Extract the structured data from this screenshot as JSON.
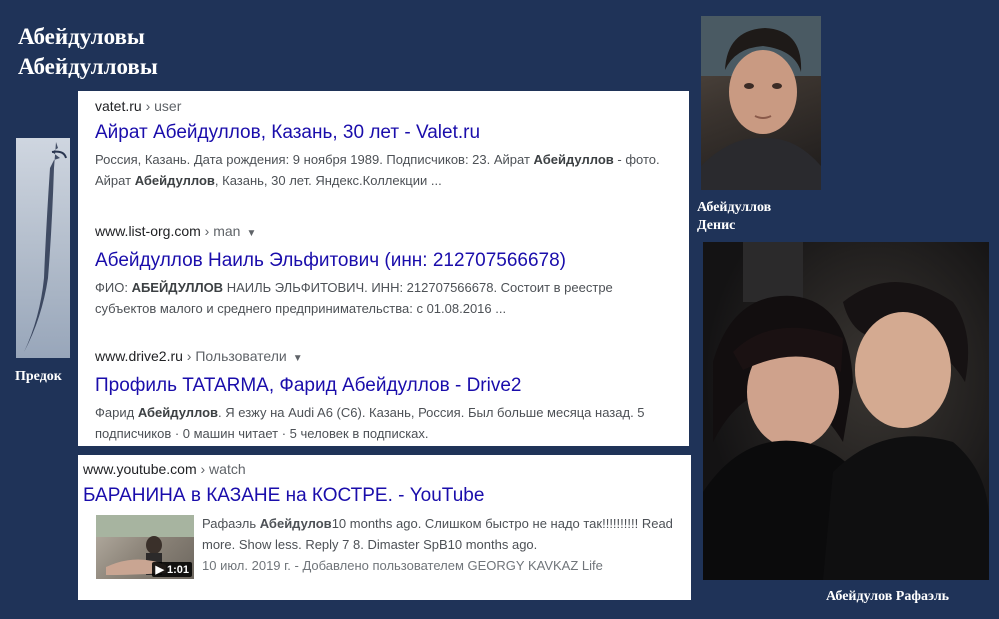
{
  "heading": {
    "line1": "Абейдуловы",
    "line2": "Абейдулловы"
  },
  "captions": {
    "ancestor": "Предок",
    "denis_line1": "Абейдуллов",
    "denis_line2": "Денис",
    "rafael": "Абейдулов Рафаэль"
  },
  "results": [
    {
      "site": "vatet.ru",
      "crumb": " › user",
      "caret": "",
      "title": "Айрат Абейдуллов, Казань, 30 лет - Valet.ru",
      "snippet": [
        {
          "t": "Россия, Казань. Дата рождения: 9 ноября 1989. Подписчиков: 23. Айрат "
        },
        {
          "b": "Абейдуллов"
        },
        {
          "t": " - фото. Айрат "
        },
        {
          "b": "Абейдуллов"
        },
        {
          "t": ", Казань, 30 лет. Яндекс.Коллекции ..."
        }
      ]
    },
    {
      "site": "www.list-org.com",
      "crumb": " › man",
      "caret": "▼",
      "title": "Абейдуллов Наиль Эльфитович (инн: 212707566678)",
      "snippet": [
        {
          "t": "ФИО: "
        },
        {
          "b": "АБЕЙДУЛЛОВ"
        },
        {
          "t": " НАИЛЬ ЭЛЬФИТОВИЧ. ИНН: 212707566678. Состоит в реестре субъектов малого и среднего предпринимательства: с 01.08.2016 ..."
        }
      ]
    },
    {
      "site": "www.drive2.ru",
      "crumb": " › Пользователи",
      "caret": "▼",
      "title": "Профиль TATARMA, Фарид Абейдуллов - Drive2",
      "snippet": [
        {
          "t": "Фарид "
        },
        {
          "b": "Абейдуллов"
        },
        {
          "t": ". Я езжу на Audi A6 (C6). Казань, Россия. Был больше месяца назад. 5 подписчиков · 0 машин читает · 5 человек в подписках."
        }
      ]
    }
  ],
  "youtube": {
    "site": "www.youtube.com",
    "crumb": " › watch",
    "title": "БАРАНИНА в КАЗАНЕ на КОСТРЕ. - YouTube",
    "duration": "▶ 1:01",
    "snippet_pre": "Рафаэль ",
    "snippet_bold": "Абейдулов",
    "snippet_post": "10 months ago. Слишком быстро не надо так!!!!!!!!!! Read more. Show less. Reply 7 8. Dimaster SpB10 months ago.",
    "date_line": "10 июл. 2019 г. - Добавлено пользователем GEORGY KAVKAZ Life"
  }
}
